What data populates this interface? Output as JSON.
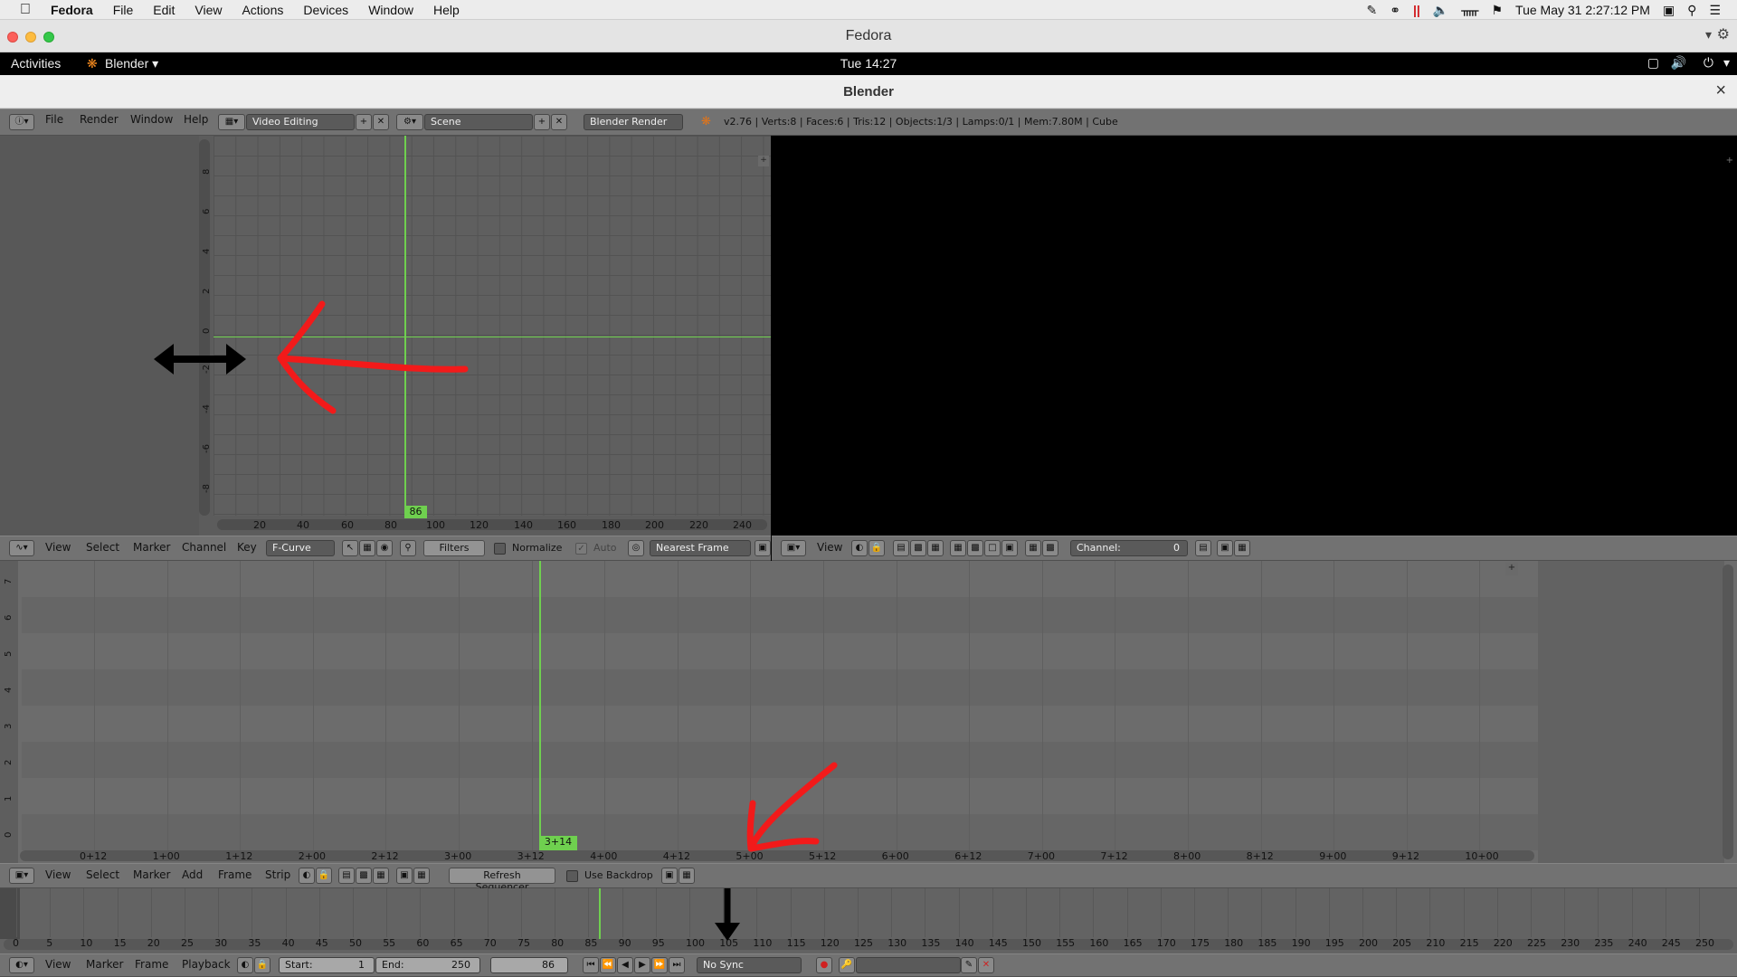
{
  "mac_menubar": {
    "apple": "",
    "app": "Fedora",
    "items": [
      "File",
      "Edit",
      "View",
      "Actions",
      "Devices",
      "Window",
      "Help"
    ],
    "clock": "Tue May 31  2:27:12 PM"
  },
  "window": {
    "title": "Fedora"
  },
  "gnome": {
    "activities": "Activities",
    "app": "Blender ▾",
    "clock": "Tue 14:27"
  },
  "blender_window": {
    "title": "Blender",
    "close": "×"
  },
  "info_header": {
    "menus": [
      "File",
      "Render",
      "Window",
      "Help"
    ],
    "screen_layout": "Video Editing",
    "scene": "Scene",
    "engine": "Blender Render",
    "stats": "v2.76 | Verts:8 | Faces:6 | Tris:12 | Objects:1/3 | Lamps:0/1 | Mem:7.80M | Cube"
  },
  "graph_editor": {
    "current_frame": "86",
    "x_ticks": [
      "20",
      "40",
      "60",
      "80",
      "100",
      "120",
      "140",
      "160",
      "180",
      "200",
      "220",
      "240"
    ],
    "y_ticks": [
      "8",
      "6",
      "4",
      "2",
      "0",
      "-2",
      "-4",
      "-6",
      "-8"
    ],
    "header": {
      "menus": [
        "View",
        "Select",
        "Marker",
        "Channel",
        "Key"
      ],
      "mode": "F-Curve",
      "filters": "Filters",
      "normalize": "Normalize",
      "auto": "Auto",
      "snap": "Nearest Frame"
    }
  },
  "preview_header": {
    "view": "View",
    "channel_label": "Channel:",
    "channel_value": "0"
  },
  "sequencer": {
    "current_frame": "3+14",
    "x_ticks": [
      "0+12",
      "1+00",
      "1+12",
      "2+00",
      "2+12",
      "3+00",
      "3+12",
      "4+00",
      "4+12",
      "5+00",
      "5+12",
      "6+00",
      "6+12",
      "7+00",
      "7+12",
      "8+00",
      "8+12",
      "9+00",
      "9+12",
      "10+00"
    ],
    "y_ticks": [
      "7",
      "6",
      "5",
      "4",
      "3",
      "2",
      "1",
      "0"
    ],
    "header": {
      "menus": [
        "View",
        "Select",
        "Marker",
        "Add",
        "Frame",
        "Strip"
      ],
      "refresh": "Refresh Sequencer",
      "backdrop": "Use Backdrop"
    }
  },
  "timeline": {
    "ticks": [
      "0",
      "5",
      "10",
      "15",
      "20",
      "25",
      "30",
      "35",
      "40",
      "45",
      "50",
      "55",
      "60",
      "65",
      "70",
      "75",
      "80",
      "85",
      "90",
      "95",
      "100",
      "105",
      "110",
      "115",
      "120",
      "125",
      "130",
      "135",
      "140",
      "145",
      "150",
      "155",
      "160",
      "165",
      "170",
      "175",
      "180",
      "185",
      "190",
      "195",
      "200",
      "205",
      "210",
      "215",
      "220",
      "225",
      "230",
      "235",
      "240",
      "245",
      "250"
    ],
    "header": {
      "menus": [
        "View",
        "Marker",
        "Frame",
        "Playback"
      ],
      "start_label": "Start:",
      "start_value": "1",
      "end_label": "End:",
      "end_value": "250",
      "current": "86",
      "sync": "No Sync"
    }
  },
  "colors": {
    "playhead": "#6fd04f",
    "annotation_red": "#f21a1a",
    "annotation_black": "#000000"
  }
}
